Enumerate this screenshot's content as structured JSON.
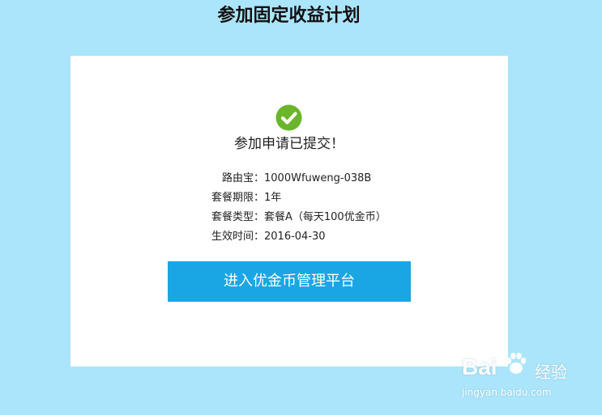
{
  "page": {
    "title": "参加固定收益计划"
  },
  "card": {
    "status_icon": "check-circle-icon",
    "status_color": "#6bb52a",
    "success_message": "参加申请已提交！",
    "details": [
      {
        "label": "路由宝：",
        "value": "1000Wfuweng-038B"
      },
      {
        "label": "套餐期限：",
        "value": "1年"
      },
      {
        "label": "套餐类型：",
        "value": "套餐A（每天100优金币）"
      },
      {
        "label": "生效时间：",
        "value": "2016-04-30"
      }
    ],
    "enter_button_label": "进入优金币管理平台",
    "button_color": "#1aa6e4"
  },
  "watermark": {
    "logo_text": "Bai",
    "logo_suffix": "经验",
    "url": "jingyan.baidu.com"
  },
  "colors": {
    "background": "#abe5fb",
    "card": "#ffffff"
  }
}
